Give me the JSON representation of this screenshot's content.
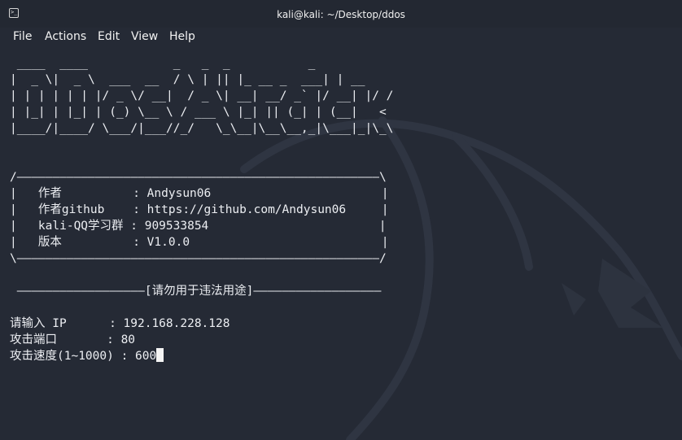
{
  "window": {
    "title": "kali@kali: ~/Desktop/ddos",
    "icon": "terminal-icon"
  },
  "menu": {
    "file": "File",
    "actions": "Actions",
    "edit": "Edit",
    "view": "View",
    "help": "Help"
  },
  "terminal": {
    "banner": [
      " ____  ____            _   _  _           _",
      "|  _ \\|  _ \\  ___  __  / \\ | || |_ __ _  ___| | __",
      "| | | | | | |/ _ \\/ __|  / _ \\| __| __/ _` |/ __| |/ /",
      "| |_| | |_| | (_) \\__ \\ / ___ \\ |_| || (_| | (__|   <",
      "|____/|____/ \\___/|___//_/   \\_\\__|\\__\\__,_|\\___|_|\\_\\"
    ],
    "info_box": [
      "/———————————————————————————————————————————————————\\",
      "|   作者          : Andysun06                        |",
      "|   作者github    : https://github.com/Andysun06     |",
      "|   kali-QQ学习群 : 909533854                        |",
      "|   版本          : V1.0.0                           |",
      "\\———————————————————————————————————————————————————/"
    ],
    "warning": " ——————————————————[请勿用于违法用途]——————————————————",
    "prompts": [
      "请输入 IP      : 192.168.228.128",
      "攻击端口       : 80"
    ],
    "speed_prompt": "攻击速度(1~1000) : 600"
  },
  "colors": {
    "background": "#252a35",
    "text": "#eceef2",
    "titlebar": "#232832"
  }
}
